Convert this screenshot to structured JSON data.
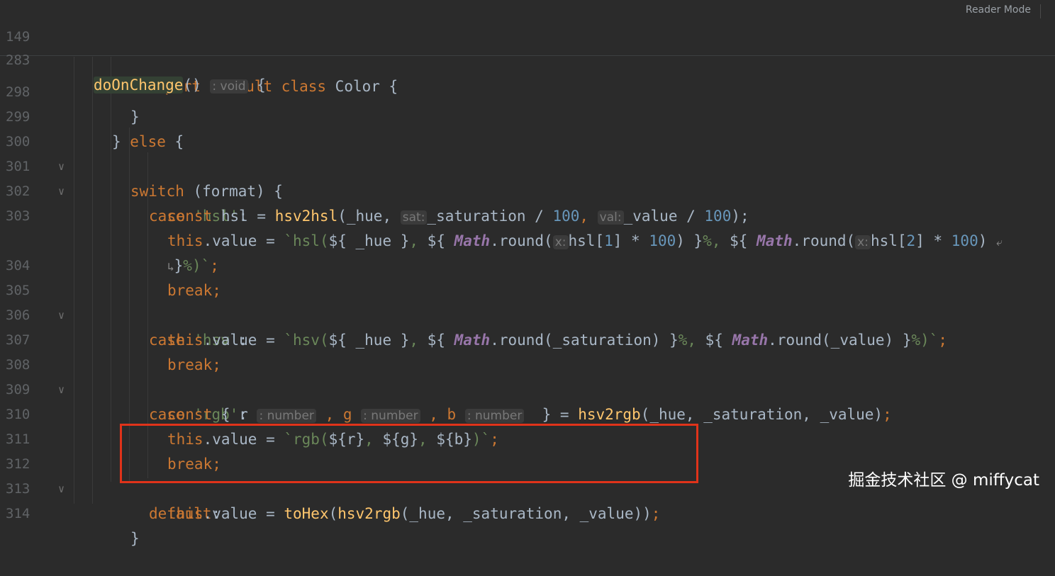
{
  "reader_mode": "Reader Mode",
  "watermark": "掘金技术社区 @ miffycat",
  "sticky": [
    {
      "num": "149",
      "code": [
        "export default class Color {"
      ]
    },
    {
      "num": "283",
      "fn": "doOnChange",
      "rest": "()",
      "hint": ": void",
      "tail": " {"
    }
  ],
  "lines": [
    {
      "num": "298"
    },
    {
      "num": "299"
    },
    {
      "num": "300"
    },
    {
      "num": "301"
    },
    {
      "num": "302"
    },
    {
      "num": "303"
    },
    {
      "num": ""
    },
    {
      "num": "304"
    },
    {
      "num": "305"
    },
    {
      "num": "306"
    },
    {
      "num": "307"
    },
    {
      "num": "308"
    },
    {
      "num": "309"
    },
    {
      "num": "310"
    },
    {
      "num": "311"
    },
    {
      "num": "312"
    },
    {
      "num": "313"
    },
    {
      "num": "314"
    }
  ],
  "tokens": {
    "l298": "}",
    "l299_a": "} ",
    "l299_b": "else",
    "l299_c": " {",
    "l300_a": "switch",
    "l300_b": " (format) {",
    "l301_a": "case ",
    "l301_b": "'hsl'",
    "l301_c": ":",
    "l302_a": "const ",
    "l302_b": "hsl = ",
    "l302_c": "hsv2hsl",
    "l302_d": "(_hue, ",
    "l302_h1": "sat:",
    "l302_e": "_saturation / ",
    "l302_n1": "100",
    "l302_f": ", ",
    "l302_h2": "val:",
    "l302_g": "_value / ",
    "l302_n2": "100",
    "l302_i": ");",
    "l303_a": "this",
    "l303_b": ".value = ",
    "l303_c": "`hsl(",
    "l303_d": "${ _hue }",
    "l303_e": ", ",
    "l303_f": "${ ",
    "l303_g": "Math",
    "l303_h": ".round(",
    "l303_hx": "x:",
    "l303_i": "hsl[",
    "l303_n1": "1",
    "l303_j": "] * ",
    "l303_n2": "100",
    "l303_k": ") }",
    "l303_l": "%, ",
    "l303_m": "${ ",
    "l303_o": "Math",
    "l303_p": ".round(",
    "l303_hx2": "x:",
    "l303_q": "hsl[",
    "l303_n3": "2",
    "l303_r": "] * ",
    "l303_n4": "100",
    "l303_s": ")",
    "l303w_a": "}",
    "l303w_b": "%)`",
    "l303w_c": ";",
    "l304": "break;",
    "l305_a": "case ",
    "l305_b": "'hsv'",
    "l305_c": ":",
    "l306_a": "this",
    "l306_b": ".value = ",
    "l306_c": "`hsv(",
    "l306_d": "${ _hue }",
    "l306_e": ", ",
    "l306_f": "${ ",
    "l306_g": "Math",
    "l306_h": ".round(_saturation) }",
    "l306_i": "%, ",
    "l306_j": "${ ",
    "l306_k": "Math",
    "l306_l": ".round(_value) }",
    "l306_m": "%)`",
    "l306_n": ";",
    "l307": "break;",
    "l308_a": "case ",
    "l308_b": "'rgb'",
    "l308_c": ":",
    "l309_a": "const ",
    "l309_b": "{ r ",
    "l309_h1": ": number",
    "l309_c": " , g ",
    "l309_h2": ": number",
    "l309_d": " , b ",
    "l309_h3": ": number",
    "l309_e": "  } = ",
    "l309_f": "hsv2rgb",
    "l309_g": "(_hue, _saturation, _value)",
    "l309_i": ";",
    "l310_a": "this",
    "l310_b": ".value = ",
    "l310_c": "`rgb(",
    "l310_d": "${r}",
    "l310_e": ", ",
    "l310_f": "${g}",
    "l310_g": ", ",
    "l310_h": "${b}",
    "l310_i": ")`",
    "l310_j": ";",
    "l311": "break;",
    "l312_a": "default",
    "l312_b": ":",
    "l313_a": "this",
    "l313_b": ".value = ",
    "l313_c": "toHex",
    "l313_d": "(",
    "l313_e": "hsv2rgb",
    "l313_f": "(_hue, _saturation, _value))",
    "l313_g": ";",
    "l314": "}"
  }
}
